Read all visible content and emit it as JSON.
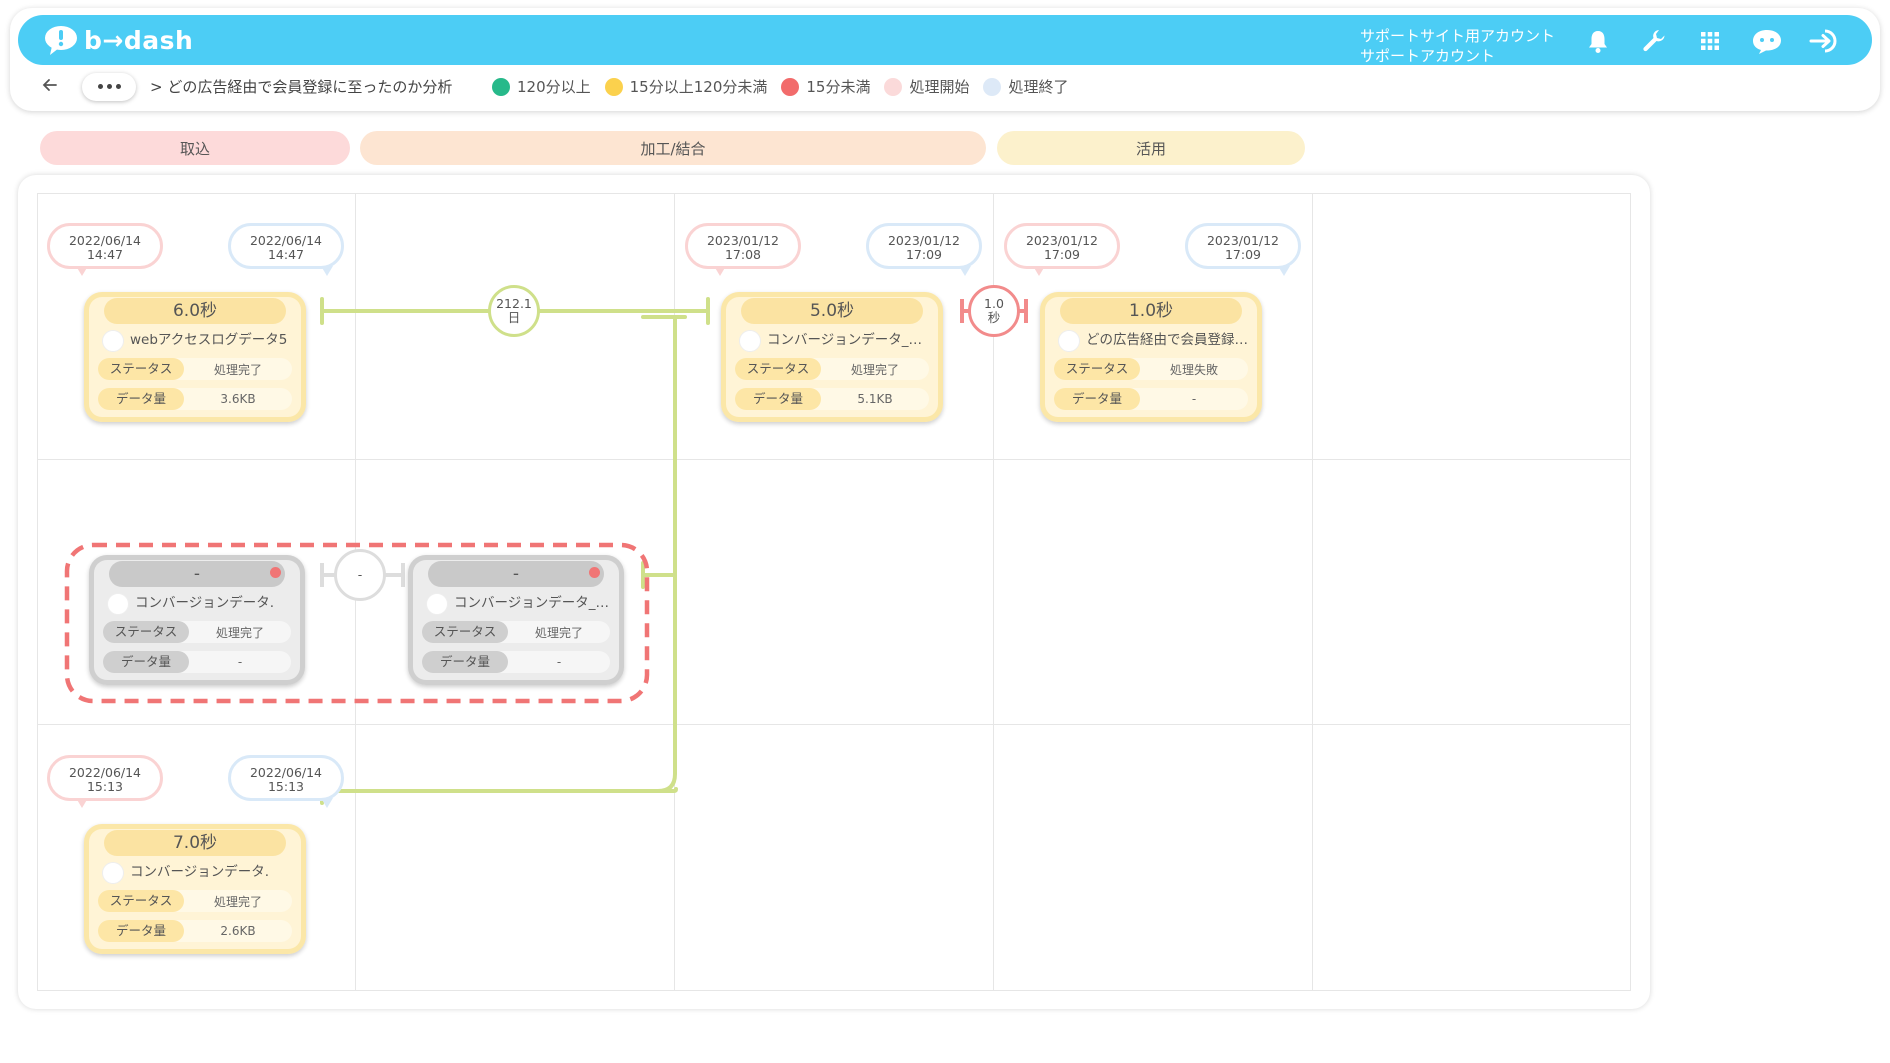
{
  "header": {
    "logo_text": "b→dash",
    "account_line1": "サポートサイト用アカウント",
    "account_line2": "サポートアカウント",
    "icons": [
      "bell-icon",
      "wrench-icon",
      "grid-apps-icon",
      "chat-bot-icon",
      "logout-icon"
    ]
  },
  "breadcrumb": {
    "more_label": "•••",
    "title": "> どの広告経由で会員登録に至ったのか分析"
  },
  "legend": [
    {
      "label": "120分以上",
      "color": "#27b98a"
    },
    {
      "label": "15分以上120分未満",
      "color": "#fbd14d"
    },
    {
      "label": "15分未満",
      "color": "#f26b6b"
    },
    {
      "label": "処理開始",
      "color": "#fbdada"
    },
    {
      "label": "処理終了",
      "color": "#dde9f7"
    }
  ],
  "phases": [
    {
      "label": "取込",
      "color": "#fddada"
    },
    {
      "label": "加工/結合",
      "color": "#fde5d2"
    },
    {
      "label": "活用",
      "color": "#fcf1cc"
    }
  ],
  "labels": {
    "status_key": "ステータス",
    "size_key": "データ量"
  },
  "cards": [
    {
      "id": "c1",
      "duration": "6.0秒",
      "name": "webアクセスログデータ5",
      "status": "処理完了",
      "size": "3.6KB",
      "start": "2022/06/14\n14:47",
      "start_date": "2022/06/14",
      "start_time": "14:47",
      "end_date": "2022/06/14",
      "end_time": "14:47",
      "style": "ok",
      "error": false
    },
    {
      "id": "c2",
      "duration": "5.0秒",
      "name": "コンバージョンデータ_…",
      "status": "処理完了",
      "size": "5.1KB",
      "start_date": "2023/01/12",
      "start_time": "17:08",
      "end_date": "2023/01/12",
      "end_time": "17:09",
      "style": "ok",
      "error": false
    },
    {
      "id": "c3",
      "duration": "1.0秒",
      "name": "どの広告経由で会員登録…",
      "status": "処理失敗",
      "size": "-",
      "start_date": "2023/01/12",
      "start_time": "17:09",
      "end_date": "2023/01/12",
      "end_time": "17:09",
      "style": "ok",
      "error": false
    },
    {
      "id": "c4",
      "duration": "-",
      "name": "コンバージョンデータ.",
      "status": "処理完了",
      "size": "-",
      "style": "grey",
      "error": true
    },
    {
      "id": "c5",
      "duration": "-",
      "name": "コンバージョンデータ_…",
      "status": "処理完了",
      "size": "-",
      "style": "grey",
      "error": true
    },
    {
      "id": "c6",
      "duration": "7.0秒",
      "name": "コンバージョンデータ.",
      "status": "処理完了",
      "size": "2.6KB",
      "start_date": "2022/06/14",
      "start_time": "15:13",
      "end_date": "2022/06/14",
      "end_time": "15:13",
      "style": "ok",
      "error": false
    }
  ],
  "gaps": [
    {
      "line1": "212.1",
      "line2": "日",
      "color": "#cfe08a"
    },
    {
      "line1": "1.0",
      "line2": "秒",
      "color": "#f28b8b"
    },
    {
      "line1": "-",
      "line2": "",
      "color": "#dddddd"
    }
  ],
  "colors": {
    "header": "#4ccdf5",
    "link": "#cfe08a",
    "alert_dash": "#f07575"
  }
}
